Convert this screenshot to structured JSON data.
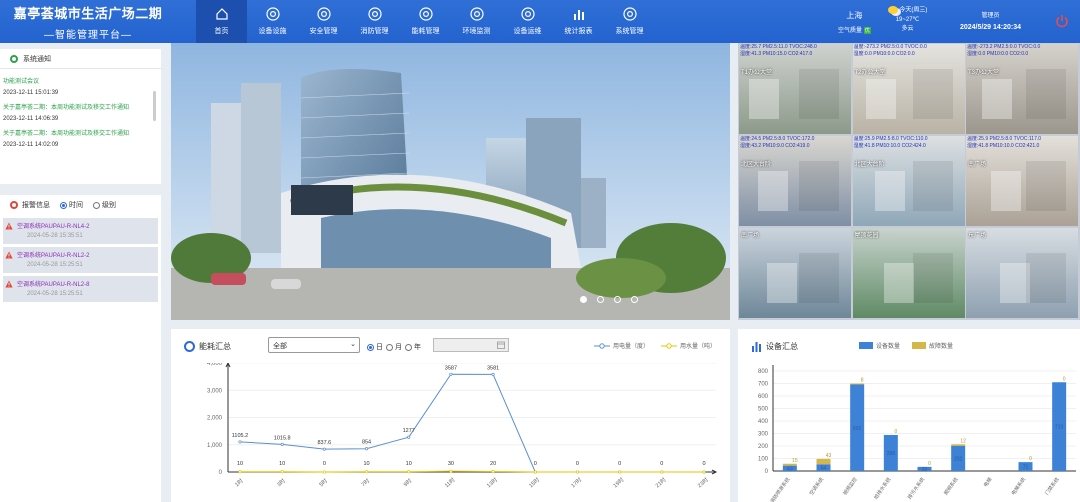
{
  "header": {
    "title": "嘉亭荟城市生活广场二期",
    "subtitle": "智能管理平台",
    "nav": [
      {
        "label": "首页",
        "icon": "home-icon",
        "active": true
      },
      {
        "label": "设备设施",
        "icon": "device-icon"
      },
      {
        "label": "安全管理",
        "icon": "security-icon"
      },
      {
        "label": "消防管理",
        "icon": "fire-icon"
      },
      {
        "label": "能耗管理",
        "icon": "energy-icon"
      },
      {
        "label": "环境监测",
        "icon": "environment-icon"
      },
      {
        "label": "设备运维",
        "icon": "maintenance-icon"
      },
      {
        "label": "统计报表",
        "icon": "chart-icon"
      },
      {
        "label": "系统管理",
        "icon": "settings-icon"
      }
    ],
    "city": "上海",
    "air_quality": "空气质量",
    "air_badge": "优",
    "weather_day": "今天(周三)",
    "weather_temp": "19~27℃",
    "weather_cond": "多云",
    "username": "管理员",
    "datetime": "2024/5/29 14:20:34"
  },
  "notice": {
    "title": "系统通知",
    "items": [
      {
        "title": "功能测试会议",
        "time": "2023-12-11 15:01:39"
      },
      {
        "title": "关于嘉亭荟二期：本周功能测试及移交工作通知",
        "time": "2023-12-11 14:06:39"
      },
      {
        "title": "关于嘉亭荟二期：本周功能测试及移交工作通知",
        "time": "2023-12-11 14:02:09"
      }
    ]
  },
  "alarm": {
    "title": "报警信息",
    "opt_time": "时间",
    "opt_level": "级别",
    "items": [
      {
        "name": "空调系统PAUPAU-R-NL4-2",
        "time": "2024-05-28 15:35:51"
      },
      {
        "name": "空调系统PAUPAU-R-NL2-2",
        "time": "2024-05-28 15:25:51"
      },
      {
        "name": "空调系统PAUPAU-R-NL2-8",
        "time": "2024-05-28 15:25:51"
      }
    ]
  },
  "cameras": [
    {
      "label": "T1办公大堂",
      "env1": "温度:25.7 PM2.5:11.0  TVOC:248.0",
      "env2": "湿度:41.3 PM10:15.0  CO2:417.0"
    },
    {
      "label": "T2办公大堂",
      "env1": "温度:-273.2 PM2.5:0.0  TVOC:0.0",
      "env2": "湿度:0.0 PM10:0.0  CO2:0.0"
    },
    {
      "label": "T3办公大堂",
      "env1": "温度:-273.2 PM2.5:0.0  TVOC:0.0",
      "env2": "湿度:0.0 PM10:0.0  CO2:0.0"
    },
    {
      "label": "北区大台阶",
      "env1": "温度:24.5 PM2.5:8.0  TVOC:172.0",
      "env2": "湿度:43.2 PM10:9.0  CO2:419.0"
    },
    {
      "label": "北区大台阶",
      "env1": "温度:25.9 PM2.5:8.0  TVOC:110.0",
      "env2": "湿度:41.8 PM10:10.0  CO2:424.0"
    },
    {
      "label": "南广场",
      "env1": "温度:25.9 PM2.5:8.0  TVOC:117.0",
      "env2": "湿度:41.8 PM10:10.0  CO2:421.0"
    },
    {
      "label": "南广场",
      "env1": "",
      "env2": ""
    },
    {
      "label": "屋顶花园",
      "env1": "",
      "env2": ""
    },
    {
      "label": "东广场",
      "env1": "",
      "env2": ""
    }
  ],
  "energy": {
    "title": "能耗汇总",
    "select": "全部",
    "opt_day": "日",
    "opt_month": "月",
    "opt_year": "年",
    "legend_elec": "用电量（度）",
    "legend_water": "用水量（吨）"
  },
  "devices": {
    "title": "设备汇总",
    "legend_count": "设备数量",
    "legend_fault": "故障数量"
  },
  "chart_data": [
    {
      "type": "line",
      "title": "能耗汇总",
      "categories": [
        "1时",
        "3时",
        "5时",
        "7时",
        "9时",
        "11时",
        "13时",
        "15时",
        "17时",
        "19时",
        "21时",
        "23时"
      ],
      "series": [
        {
          "name": "用电量（度）",
          "values": [
            1105.2,
            1015.8,
            837.6,
            854,
            1277,
            3587,
            3581,
            0,
            0,
            0,
            0,
            0
          ],
          "color": "#5b8fd1"
        },
        {
          "name": "用水量（吨）",
          "values": [
            10,
            10,
            0,
            10,
            10,
            30,
            20,
            0,
            0,
            0,
            0,
            0
          ],
          "color": "#e6c700"
        }
      ],
      "elec_labels": [
        "1105.2",
        "1015.8",
        "837.6",
        "854",
        "1277",
        "3587",
        "3581",
        "",
        "",
        "",
        "",
        ""
      ],
      "water_labels": [
        "10",
        "10",
        "0",
        "10",
        "10",
        "30",
        "20",
        "0",
        "0",
        "0",
        "0",
        "0"
      ],
      "ylim": [
        0,
        4000
      ],
      "yticks": [
        "0",
        "1,000",
        "2,000",
        "3,000",
        "4,000"
      ]
    },
    {
      "type": "bar",
      "title": "设备汇总",
      "categories": [
        "消防喷淋系统",
        "空调系统",
        "视频监控",
        "给排水系统",
        "排污水系统",
        "照明系统",
        "电梯",
        "电梯系统",
        "门禁系统"
      ],
      "series": [
        {
          "name": "设备数量",
          "values": [
            43,
            54,
            692,
            288,
            33,
            202,
            0,
            71,
            710
          ],
          "color": "#3d82d6"
        },
        {
          "name": "故障数量",
          "values": [
            15,
            43,
            8,
            0,
            0,
            12,
            0,
            0,
            0
          ],
          "color": "#d4b74a"
        }
      ],
      "count_labels": [
        "43",
        "54",
        "692",
        "288",
        "33",
        "202",
        "",
        "71",
        "710"
      ],
      "fault_labels": [
        "15",
        "43",
        "8",
        "0",
        "0",
        "12",
        "",
        "0",
        "0"
      ],
      "ylim": [
        0,
        800
      ],
      "yticks": [
        "0",
        "100",
        "200",
        "300",
        "400",
        "500",
        "600",
        "700",
        "800"
      ]
    }
  ]
}
